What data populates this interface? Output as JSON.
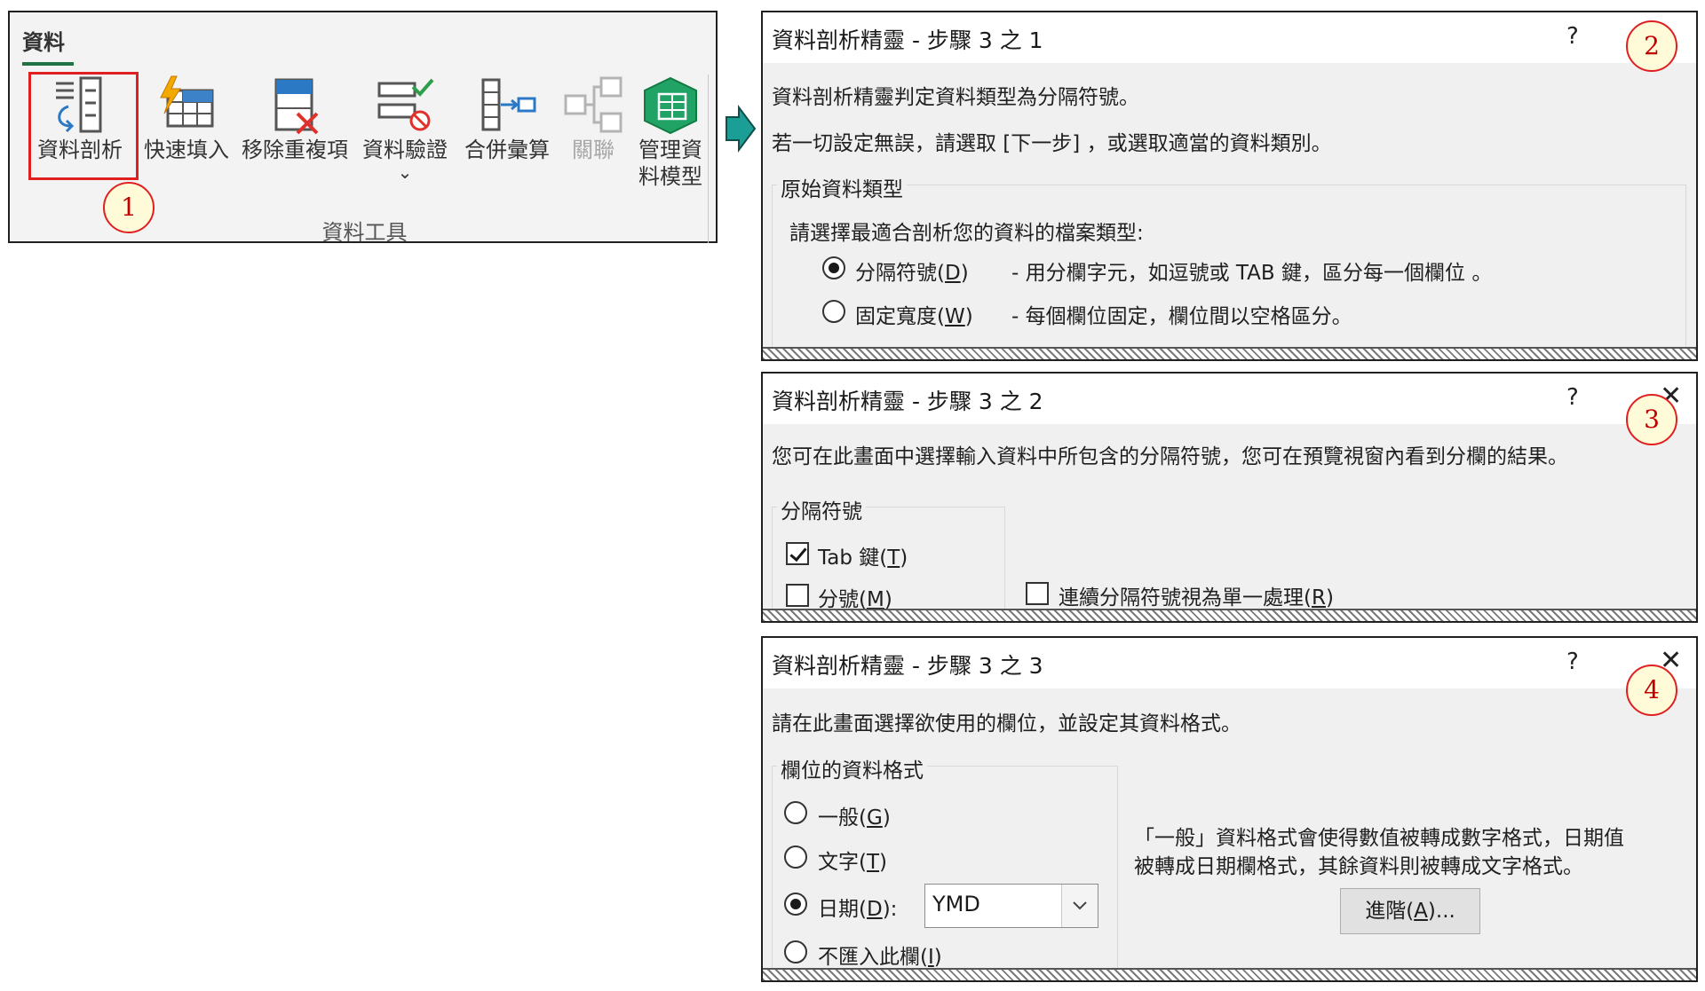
{
  "ribbon": {
    "tab_label": "資料",
    "group_label": "資料工具",
    "buttons": [
      {
        "label": "資料剖析",
        "icon": "text-to-columns-icon"
      },
      {
        "label": "快速填入",
        "icon": "flash-fill-icon"
      },
      {
        "label": "移除重複項",
        "icon": "remove-duplicates-icon"
      },
      {
        "label": "資料驗證",
        "sub": "⌄",
        "icon": "data-validation-icon"
      },
      {
        "label": "合併彙算",
        "icon": "consolidate-icon"
      },
      {
        "label": "關聯",
        "icon": "relationships-icon",
        "disabled": true
      },
      {
        "label": "管理資",
        "label2": "料模型",
        "icon": "data-model-icon"
      }
    ]
  },
  "steps": [
    "1",
    "2",
    "3",
    "4"
  ],
  "dialog1": {
    "title": "資料剖析精靈 - 步驟 3 之 1",
    "help": "?",
    "line1": "資料剖析精靈判定資料類型為分隔符號。",
    "line2": "若一切設定無誤，請選取 [下一步] ，或選取適當的資料類別。",
    "group_title": "原始資料類型",
    "prompt": "請選擇最適合剖析您的資料的檔案類型:",
    "options": [
      {
        "label_pre": "分隔符號(",
        "key": "D",
        "label_post": ")",
        "desc": "-  用分欄字元，如逗號或 TAB 鍵，區分每一個欄位  。",
        "selected": true
      },
      {
        "label_pre": "固定寬度(",
        "key": "W",
        "label_post": ")",
        "desc": "-  每個欄位固定，欄位間以空格區分。",
        "selected": false
      }
    ]
  },
  "dialog2": {
    "title": "資料剖析精靈 - 步驟 3 之 2",
    "help": "?",
    "close": "✕",
    "line1": "您可在此畫面中選擇輸入資料中所包含的分隔符號，您可在預覽視窗內看到分欄的結果。",
    "group_title": "分隔符號",
    "checkboxes": [
      {
        "label_pre": "Tab 鍵(",
        "key": "T",
        "label_post": ")",
        "checked": true
      },
      {
        "label_pre": "分號(",
        "key": "M",
        "label_post": ")",
        "checked": false
      }
    ],
    "consecutive": {
      "label_pre": "連續分隔符號視為單一處理(",
      "key": "R",
      "label_post": ")",
      "checked": false
    }
  },
  "dialog3": {
    "title": "資料剖析精靈 - 步驟 3 之 3",
    "help": "?",
    "close": "✕",
    "line1": "請在此畫面選擇欲使用的欄位，並設定其資料格式。",
    "group_title": "欄位的資料格式",
    "options": [
      {
        "label_pre": "一般(",
        "key": "G",
        "label_post": ")",
        "selected": false
      },
      {
        "label_pre": "文字(",
        "key": "T",
        "label_post": ")",
        "selected": false
      },
      {
        "label_pre": "日期(",
        "key": "D",
        "label_post": "):",
        "selected": true
      },
      {
        "label_pre": "不匯入此欄(",
        "key": "I",
        "label_post": ")",
        "selected": false
      }
    ],
    "date_format": "YMD",
    "info1": "「一般」資料格式會使得數值被轉成數字格式，日期值",
    "info2": "被轉成日期欄格式，其餘資料則被轉成文字格式。",
    "advanced_pre": "進階(",
    "advanced_key": "A",
    "advanced_post": ")..."
  },
  "colors": {
    "highlight": "#e02020",
    "step_fill": "#fffbd8",
    "arrow": "#1a9e96",
    "excel_green": "#217346"
  }
}
